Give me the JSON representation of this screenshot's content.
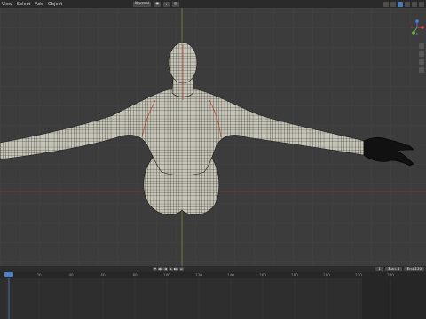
{
  "header": {
    "menu": [
      "View",
      "Select",
      "Add",
      "Object"
    ],
    "mode_label": "Normal",
    "colors": {
      "bg": "#2a2a2a",
      "accent": "#4b7bbd"
    }
  },
  "viewport": {
    "background": "#3c3c3c",
    "grid_color": "#474747",
    "x_axis_color": "#8a3a3a",
    "y_axis_color": "#7a8a3a",
    "mesh_fill": "#c7c6b8",
    "mesh_wire": "#1a1a1a",
    "seam_color": "#c0392b",
    "gizmo": {
      "x_color": "#e04a4a",
      "y_color": "#6fb83a",
      "z_color": "#4a7fe0"
    }
  },
  "timeline": {
    "playback_buttons": [
      "⏮",
      "◀◀",
      "◀",
      "▶",
      "▶▶",
      "⏭"
    ],
    "start_label": "Start",
    "start_value": "1",
    "end_label": "End",
    "end_value": "250",
    "current_frame": "1",
    "ruler_ticks": [
      "0",
      "20",
      "40",
      "60",
      "80",
      "100",
      "120",
      "140",
      "160",
      "180",
      "200",
      "220",
      "240"
    ]
  }
}
